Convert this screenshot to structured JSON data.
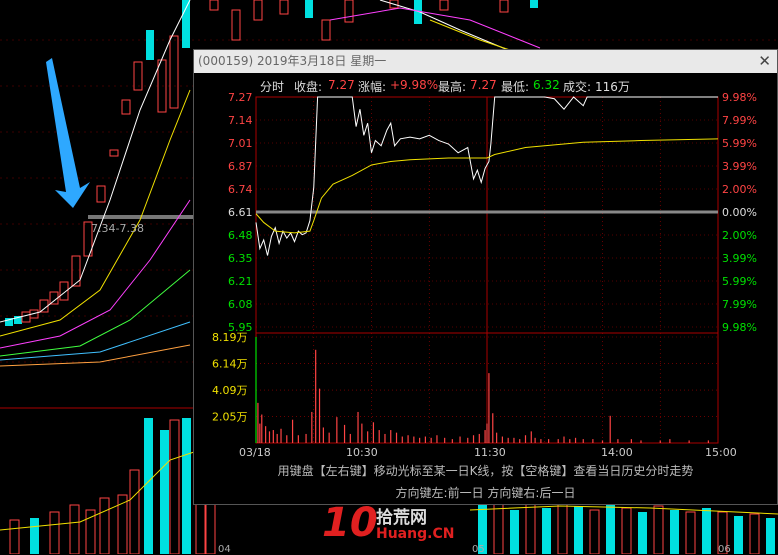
{
  "colors": {
    "up": "#ff4444",
    "down": "#00e0e0",
    "price_line": "#ffffff",
    "avg_line": "#f0e000",
    "axis": "#aa0000"
  },
  "popup": {
    "title": "(000159) 2019年3月18日 星期一",
    "close_icon": "close-icon"
  },
  "info": {
    "label": "分时",
    "close_label": "收盘:",
    "close_value": "7.27",
    "change_label": "涨幅:",
    "change_value": "+9.98%",
    "high_label": "最高:",
    "high_value": "7.27",
    "low_label": "最低:",
    "low_value": "6.32",
    "volume_label": "成交:",
    "volume_value": "116万"
  },
  "chart_data": {
    "type": "line",
    "price_ticks": [
      "7.27",
      "7.14",
      "7.01",
      "6.87",
      "6.74",
      "6.61",
      "6.48",
      "6.35",
      "6.21",
      "6.08",
      "5.95"
    ],
    "pct_ticks": [
      "9.98%",
      "7.99%",
      "5.99%",
      "3.99%",
      "2.00%",
      "0.00%",
      "2.00%",
      "3.99%",
      "5.99%",
      "7.99%",
      "9.98%"
    ],
    "volume_ticks": [
      "8.19万",
      "6.14万",
      "4.09万",
      "2.05万"
    ],
    "x_ticks": [
      "03/18",
      "10:30",
      "11:30",
      "14:00",
      "15:00"
    ],
    "prev_close": 6.61,
    "ylim": [
      5.95,
      7.27
    ],
    "price": [
      [
        0,
        6.55
      ],
      [
        2,
        6.4
      ],
      [
        4,
        6.45
      ],
      [
        6,
        6.36
      ],
      [
        8,
        6.47
      ],
      [
        10,
        6.52
      ],
      [
        12,
        6.43
      ],
      [
        14,
        6.5
      ],
      [
        16,
        6.46
      ],
      [
        18,
        6.49
      ],
      [
        20,
        6.44
      ],
      [
        22,
        6.5
      ],
      [
        24,
        6.48
      ],
      [
        26,
        6.49
      ],
      [
        28,
        6.56
      ],
      [
        30,
        6.75
      ],
      [
        32,
        7.27
      ],
      [
        36,
        7.27
      ],
      [
        38,
        7.27
      ],
      [
        45,
        7.27
      ],
      [
        50,
        7.27
      ],
      [
        52,
        7.1
      ],
      [
        54,
        7.2
      ],
      [
        56,
        7.05
      ],
      [
        58,
        7.12
      ],
      [
        60,
        6.95
      ],
      [
        62,
        7.02
      ],
      [
        65,
        6.99
      ],
      [
        68,
        7.08
      ],
      [
        70,
        7.12
      ],
      [
        72,
        6.99
      ],
      [
        75,
        7.03
      ],
      [
        80,
        7.04
      ],
      [
        85,
        7.03
      ],
      [
        90,
        7.05
      ],
      [
        95,
        7.02
      ],
      [
        100,
        7.0
      ],
      [
        105,
        6.95
      ],
      [
        110,
        6.98
      ],
      [
        113,
        6.8
      ],
      [
        115,
        6.85
      ],
      [
        117,
        6.78
      ],
      [
        119,
        6.86
      ],
      [
        121,
        6.9
      ],
      [
        122,
        7.0
      ],
      [
        124,
        7.27
      ],
      [
        150,
        7.27
      ],
      [
        155,
        7.26
      ],
      [
        160,
        7.2
      ],
      [
        165,
        7.27
      ],
      [
        170,
        7.22
      ],
      [
        172,
        7.27
      ],
      [
        240,
        7.27
      ]
    ],
    "avg": [
      [
        0,
        6.6
      ],
      [
        4,
        6.55
      ],
      [
        10,
        6.5
      ],
      [
        20,
        6.49
      ],
      [
        28,
        6.5
      ],
      [
        30,
        6.56
      ],
      [
        34,
        6.69
      ],
      [
        40,
        6.77
      ],
      [
        50,
        6.82
      ],
      [
        60,
        6.88
      ],
      [
        70,
        6.9
      ],
      [
        80,
        6.91
      ],
      [
        100,
        6.92
      ],
      [
        120,
        6.92
      ],
      [
        124,
        6.94
      ],
      [
        140,
        6.98
      ],
      [
        170,
        7.01
      ],
      [
        200,
        7.02
      ],
      [
        240,
        7.03
      ]
    ],
    "volume": [
      [
        0,
        8.19
      ],
      [
        1,
        3.1
      ],
      [
        2,
        1.5
      ],
      [
        3,
        2.2
      ],
      [
        5,
        1.3
      ],
      [
        7,
        0.9
      ],
      [
        9,
        1.0
      ],
      [
        11,
        0.7
      ],
      [
        13,
        1.1
      ],
      [
        16,
        0.6
      ],
      [
        19,
        1.8
      ],
      [
        22,
        0.6
      ],
      [
        26,
        0.7
      ],
      [
        29,
        2.4
      ],
      [
        31,
        7.2
      ],
      [
        33,
        4.2
      ],
      [
        35,
        1.2
      ],
      [
        38,
        0.8
      ],
      [
        42,
        2.0
      ],
      [
        46,
        1.4
      ],
      [
        49,
        0.7
      ],
      [
        53,
        2.4
      ],
      [
        55,
        1.5
      ],
      [
        58,
        0.9
      ],
      [
        61,
        1.6
      ],
      [
        64,
        1.0
      ],
      [
        67,
        0.7
      ],
      [
        70,
        1.0
      ],
      [
        73,
        0.8
      ],
      [
        76,
        0.5
      ],
      [
        79,
        0.6
      ],
      [
        82,
        0.5
      ],
      [
        85,
        0.4
      ],
      [
        88,
        0.5
      ],
      [
        91,
        0.4
      ],
      [
        94,
        0.6
      ],
      [
        98,
        0.4
      ],
      [
        102,
        0.3
      ],
      [
        106,
        0.5
      ],
      [
        110,
        0.4
      ],
      [
        113,
        0.6
      ],
      [
        116,
        0.7
      ],
      [
        119,
        1.0
      ],
      [
        120,
        1.5
      ],
      [
        121,
        5.4
      ],
      [
        123,
        2.3
      ],
      [
        125,
        0.8
      ],
      [
        128,
        0.5
      ],
      [
        131,
        0.4
      ],
      [
        134,
        0.4
      ],
      [
        137,
        0.3
      ],
      [
        140,
        0.6
      ],
      [
        143,
        0.9
      ],
      [
        145,
        0.4
      ],
      [
        148,
        0.3
      ],
      [
        152,
        0.3
      ],
      [
        157,
        0.3
      ],
      [
        160,
        0.5
      ],
      [
        163,
        0.3
      ],
      [
        166,
        0.4
      ],
      [
        170,
        0.3
      ],
      [
        175,
        0.3
      ],
      [
        180,
        0.2
      ],
      [
        184,
        2.1
      ],
      [
        188,
        0.3
      ],
      [
        195,
        0.3
      ],
      [
        200,
        0.2
      ],
      [
        210,
        0.2
      ],
      [
        215,
        0.3
      ],
      [
        225,
        0.2
      ],
      [
        235,
        0.2
      ]
    ]
  },
  "kline": {
    "range_label": "7.34-7.38",
    "date_ticks": [
      "04",
      "05",
      "06"
    ]
  },
  "hint": {
    "line1": "用键盘【左右键】移动光标至某一日K线，按【空格键】查看当日历史分时走势",
    "line2": "方向键左:前一日    方向键右:后一日"
  },
  "watermark": {
    "text1": "拾荒网",
    "text2": "Huang.CN",
    "num": "10"
  }
}
